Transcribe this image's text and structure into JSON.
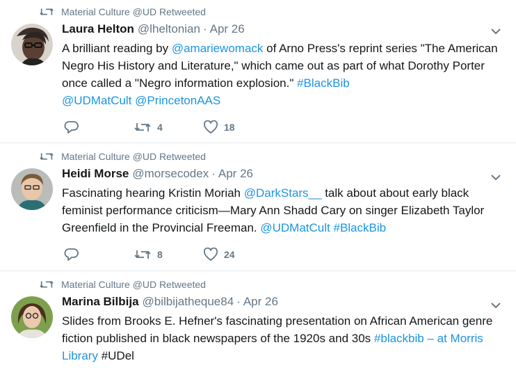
{
  "colors": {
    "link": "#1b95e0",
    "secondary": "#657786",
    "text": "#14171a",
    "divider": "#e6ecf0"
  },
  "tweets": [
    {
      "retweeted_by": "Material Culture @UD Retweeted",
      "name": "Laura Helton",
      "handle": "@lheltonian",
      "separator": "·",
      "time": "Apr 26",
      "text_parts": [
        "A brilliant reading by ",
        "@amariewomack",
        " of Arno Press's reprint series \"The American Negro His History and Literature,\" which came out as part of what Dorothy Porter once called a \"Negro information explosion.\" ",
        "#BlackBib",
        "@UDMatCult",
        "@PrincetonAAS"
      ],
      "retweets": "4",
      "likes": "18"
    },
    {
      "retweeted_by": "Material Culture @UD Retweeted",
      "name": "Heidi Morse",
      "handle": "@morsecodex",
      "separator": "·",
      "time": "Apr 26",
      "text_parts": [
        "Fascinating hearing Kristin Moriah ",
        "@DarkStars__",
        "  talk about about early black feminist performance criticism—Mary Ann Shadd Cary on singer Elizabeth Taylor Greenfield in the Provincial Freeman. ",
        "@UDMatCult",
        "#BlackBib"
      ],
      "retweets": "8",
      "likes": "24"
    },
    {
      "retweeted_by": "Material Culture @UD Retweeted",
      "name": "Marina Bilbija",
      "handle": "@bilbijatheque84",
      "separator": "·",
      "time": "Apr 26",
      "text_parts": [
        "Slides from Brooks E. Hefner's fascinating presentation on African American genre fiction published in black newspapers of the 1920s and 30s ",
        "#blackbib",
        " – at Morris Library",
        " #UDel"
      ]
    }
  ],
  "icons": {
    "retweet": "retweet-icon",
    "reply": "reply-icon",
    "like": "heart-icon",
    "caret": "chevron-down-icon"
  }
}
